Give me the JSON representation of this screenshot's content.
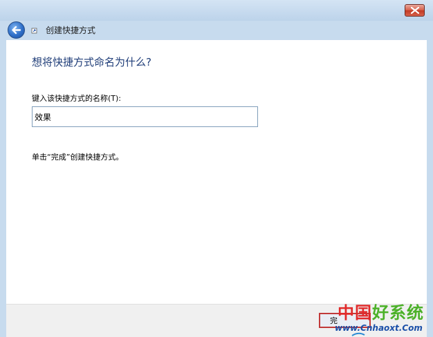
{
  "nav": {
    "title": "创建快捷方式"
  },
  "main": {
    "heading": "想将快捷方式命名为什么?",
    "field_label": "键入该快捷方式的名称(T):",
    "name_value": "效果",
    "hint": "单击“完成”创建快捷方式。"
  },
  "footer": {
    "finish_label": "完"
  },
  "watermark": {
    "cn_part1": "中国",
    "cn_part2": "好系统",
    "url": "www.Cnhaoxt.Com"
  },
  "colors": {
    "heading": "#1f3d78",
    "close_button": "#c23a24",
    "frame": "#c7dbee",
    "watermark_red": "#e12a2a",
    "watermark_green": "#4bb128",
    "watermark_blue": "#1b4fa8"
  }
}
